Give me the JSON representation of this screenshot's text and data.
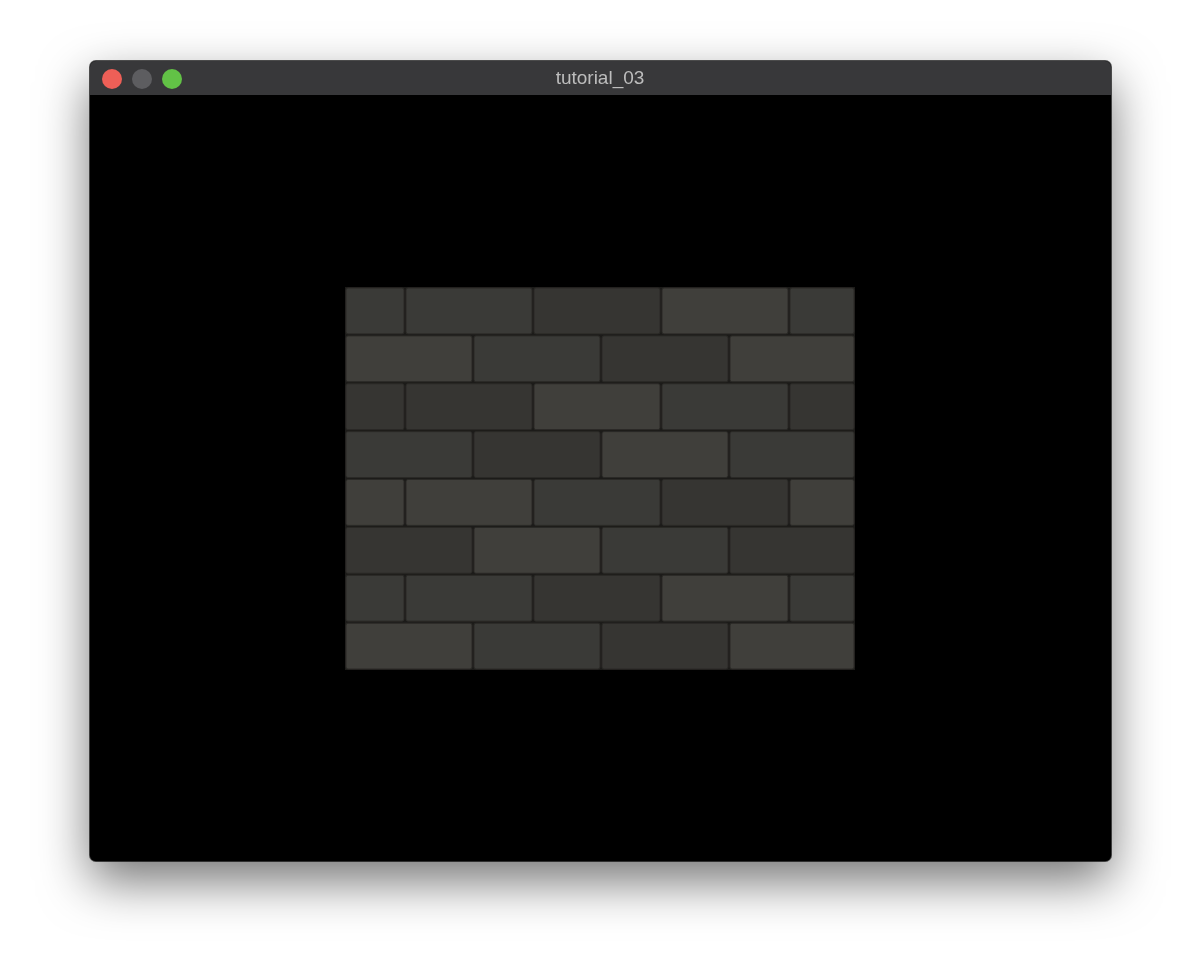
{
  "window": {
    "title": "tutorial_03"
  },
  "window_controls": [
    {
      "kind": "close",
      "disabled": false
    },
    {
      "kind": "minimize",
      "disabled": true
    },
    {
      "kind": "zoom",
      "disabled": false
    }
  ]
}
